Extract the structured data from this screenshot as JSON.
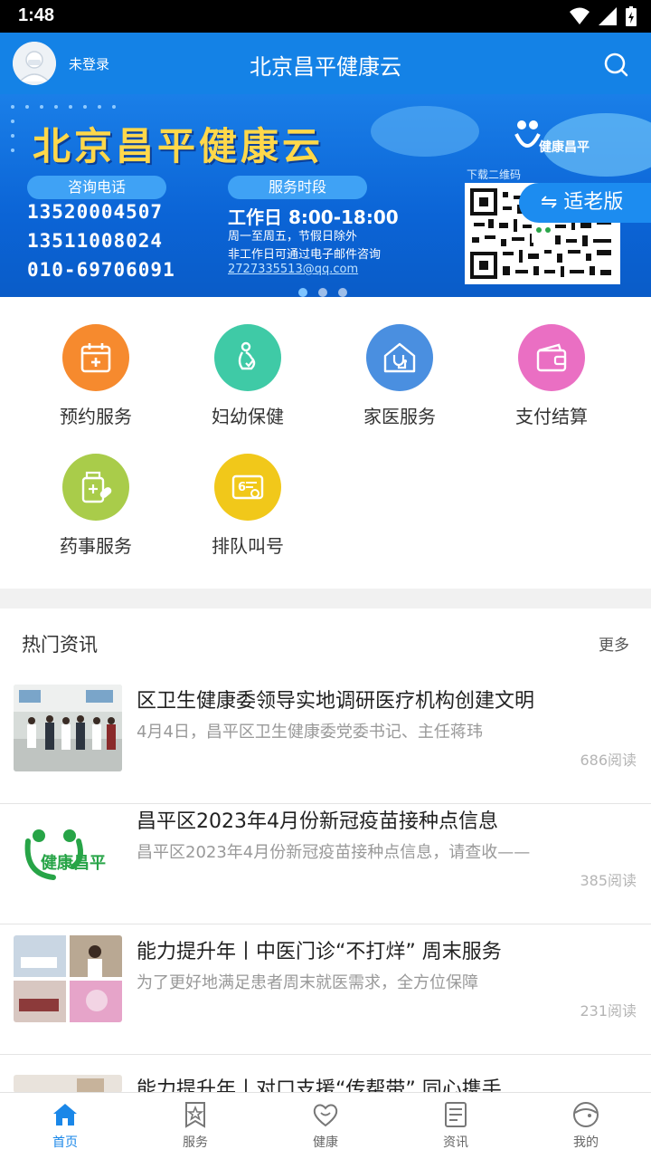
{
  "status_bar": {
    "time": "1:48"
  },
  "header": {
    "login_status": "未登录",
    "title": "北京昌平健康云",
    "accent_color": "#1482e6"
  },
  "banner": {
    "title": "北京昌平健康云",
    "hotline_label": "咨询电话",
    "hotlines": [
      "13520004507",
      "13511008024",
      "010-69706091"
    ],
    "hours_label": "服务时段",
    "hours": "工作日 8:00-18:00",
    "note_1": "周一至周五，节假日除外",
    "note_2": "非工作日可通过电子邮件咨询",
    "email": "2727335513@qq.com",
    "qr_label": "下载二维码",
    "logo_text": "健康昌平",
    "elder_button": "⇋ 适老版"
  },
  "services": [
    {
      "label": "预约服务",
      "color": "#f68a2e",
      "icon": "calendar-icon"
    },
    {
      "label": "妇幼保健",
      "color": "#3fcaa6",
      "icon": "mother-child-icon"
    },
    {
      "label": "家医服务",
      "color": "#4a8fe0",
      "icon": "stethoscope-home-icon"
    },
    {
      "label": "支付结算",
      "color": "#ea6fc3",
      "icon": "wallet-icon"
    },
    {
      "label": "药事服务",
      "color": "#a9cc4a",
      "icon": "medicine-icon"
    },
    {
      "label": "排队叫号",
      "color": "#f1c81a",
      "icon": "queue-ticket-icon"
    }
  ],
  "news": {
    "section_title": "热门资讯",
    "more_label": "更多",
    "items": [
      {
        "title": "区卫生健康委领导实地调研医疗机构创建文明",
        "summary": "4月4日，昌平区卫生健康委党委书记、主任蒋玮",
        "reads": "686阅读"
      },
      {
        "title": "昌平区2023年4月份新冠疫苗接种点信息",
        "summary": "昌平区2023年4月份新冠疫苗接种点信息，请查收——",
        "reads": "385阅读"
      },
      {
        "title": "能力提升年丨中医门诊“不打烊” 周末服务",
        "summary": "为了更好地满足患者周末就医需求，全方位保障",
        "reads": "231阅读"
      },
      {
        "title": "能力提升年丨对口支援“传帮带” 同心携手",
        "summary": "",
        "reads": ""
      }
    ]
  },
  "tabbar": [
    {
      "label": "首页",
      "active": true
    },
    {
      "label": "服务",
      "active": false
    },
    {
      "label": "健康",
      "active": false
    },
    {
      "label": "资讯",
      "active": false
    },
    {
      "label": "我的",
      "active": false
    }
  ]
}
